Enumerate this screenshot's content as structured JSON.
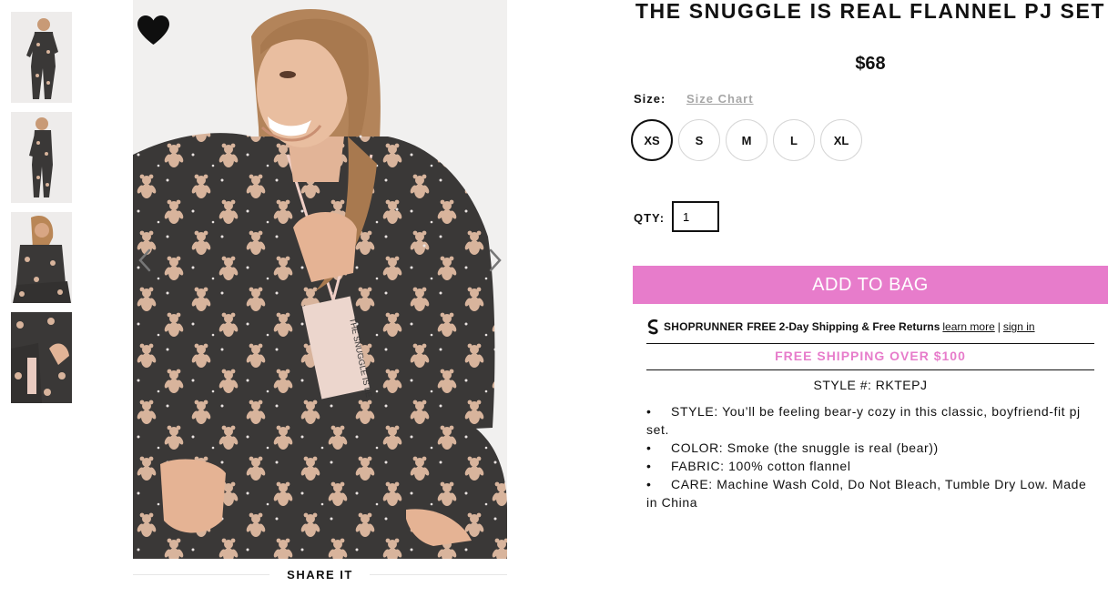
{
  "product": {
    "title": "THE SNUGGLE IS REAL FLANNEL PJ SET",
    "price": "$68",
    "style_number": "STYLE #: RKTEPJ"
  },
  "size": {
    "label": "Size:",
    "chart_link": "Size Chart",
    "options": [
      "XS",
      "S",
      "M",
      "L",
      "XL"
    ],
    "selected": "XS"
  },
  "quantity": {
    "label": "QTY:",
    "value": "1"
  },
  "actions": {
    "add_to_bag": "ADD TO BAG"
  },
  "shoprunner": {
    "brand": "SHOPRUNNER",
    "text": "FREE 2-Day Shipping & Free Returns",
    "learn_more": "learn more",
    "separator": "|",
    "sign_in": "sign in"
  },
  "shipping_banner": "FREE SHIPPING OVER $100",
  "description": [
    "STYLE: You’ll be feeling bear-y cozy in this classic, boyfriend-fit pj set.",
    "COLOR: Smoke (the snuggle is real (bear))",
    "FABRIC: 100% cotton flannel",
    "CARE: Machine Wash Cold, Do Not Bleach, Tumble Dry Low. Made in China"
  ],
  "bullet": "•",
  "share": {
    "label": "SHARE IT"
  },
  "icons": {
    "favorite": "heart-icon",
    "prev": "chevron-left-icon",
    "next": "chevron-right-icon",
    "shoprunner": "shoprunner-logo-icon"
  },
  "colors": {
    "accent_pink": "#e77ccb",
    "pajama_charcoal": "#3a3837",
    "bear_tan": "#d8b49c",
    "link_gray": "#a6a6a6"
  }
}
